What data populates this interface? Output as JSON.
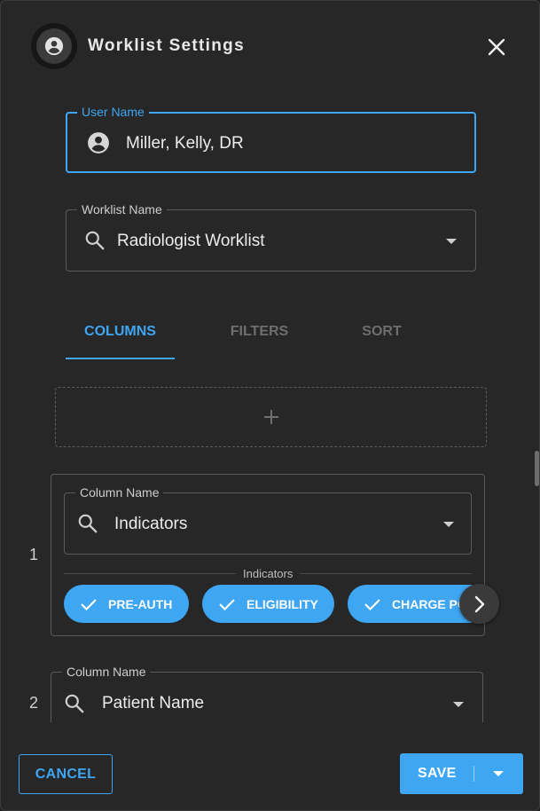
{
  "dialog": {
    "title": "Worklist Settings",
    "avatar_icon": "account-circle-icon",
    "close_icon": "close-icon"
  },
  "user_name": {
    "label": "User Name",
    "value": "Miller, Kelly, DR",
    "icon": "account-circle-icon"
  },
  "worklist_name": {
    "label": "Worklist Name",
    "value": "Radiologist Worklist",
    "icon": "search-icon"
  },
  "tabs": [
    {
      "label": "COLUMNS",
      "active": true
    },
    {
      "label": "FILTERS",
      "active": false
    },
    {
      "label": "SORT",
      "active": false
    }
  ],
  "add_column": {
    "icon": "plus-icon"
  },
  "columns": [
    {
      "number": "1",
      "label": "Column Name",
      "value": "Indicators",
      "indicators_label": "Indicators",
      "chips": [
        {
          "label": "PRE-AUTH",
          "checked": true
        },
        {
          "label": "ELIGIBILITY",
          "checked": true
        },
        {
          "label": "CHARGE POSTED",
          "checked": true
        }
      ]
    },
    {
      "number": "2",
      "label": "Column Name",
      "value": "Patient Name"
    }
  ],
  "footer": {
    "cancel_label": "CANCEL",
    "save_label": "SAVE"
  },
  "colors": {
    "accent": "#3ea6f2",
    "background": "#272727"
  }
}
